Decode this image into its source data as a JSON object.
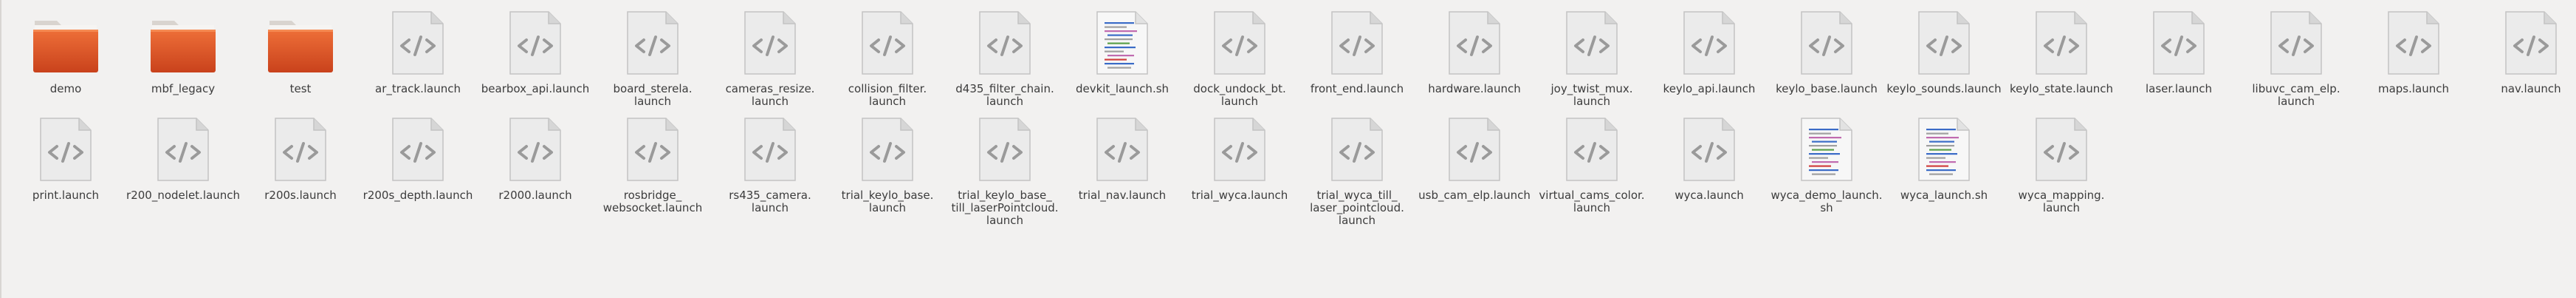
{
  "files": [
    {
      "name": "demo",
      "icon": "folder-icon"
    },
    {
      "name": "mbf_legacy",
      "icon": "folder-icon"
    },
    {
      "name": "test",
      "icon": "folder-icon"
    },
    {
      "name": "ar_track.launch",
      "icon": "code-file-icon"
    },
    {
      "name": "bearbox_api.launch",
      "icon": "code-file-icon"
    },
    {
      "name": "board_sterela.\nlaunch",
      "icon": "code-file-icon"
    },
    {
      "name": "cameras_resize.\nlaunch",
      "icon": "code-file-icon"
    },
    {
      "name": "collision_filter.\nlaunch",
      "icon": "code-file-icon"
    },
    {
      "name": "d435_filter_chain.\nlaunch",
      "icon": "code-file-icon"
    },
    {
      "name": "devkit_launch.sh",
      "icon": "script-file-icon"
    },
    {
      "name": "dock_undock_bt.\nlaunch",
      "icon": "code-file-icon"
    },
    {
      "name": "front_end.launch",
      "icon": "code-file-icon"
    },
    {
      "name": "hardware.launch",
      "icon": "code-file-icon"
    },
    {
      "name": "joy_twist_mux.\nlaunch",
      "icon": "code-file-icon"
    },
    {
      "name": "keylo_api.launch",
      "icon": "code-file-icon"
    },
    {
      "name": "keylo_base.launch",
      "icon": "code-file-icon"
    },
    {
      "name": "keylo_sounds.launch",
      "icon": "code-file-icon"
    },
    {
      "name": "keylo_state.launch",
      "icon": "code-file-icon"
    },
    {
      "name": "laser.launch",
      "icon": "code-file-icon"
    },
    {
      "name": "libuvc_cam_elp.\nlaunch",
      "icon": "code-file-icon"
    },
    {
      "name": "maps.launch",
      "icon": "code-file-icon"
    },
    {
      "name": "nav.launch",
      "icon": "code-file-icon"
    },
    {
      "name": "print.launch",
      "icon": "code-file-icon"
    },
    {
      "name": "r200_nodelet.launch",
      "icon": "code-file-icon"
    },
    {
      "name": "r200s.launch",
      "icon": "code-file-icon"
    },
    {
      "name": "r200s_depth.launch",
      "icon": "code-file-icon"
    },
    {
      "name": "r2000.launch",
      "icon": "code-file-icon"
    },
    {
      "name": "rosbridge_\nwebsocket.launch",
      "icon": "code-file-icon"
    },
    {
      "name": "rs435_camera.\nlaunch",
      "icon": "code-file-icon"
    },
    {
      "name": "trial_keylo_base.\nlaunch",
      "icon": "code-file-icon"
    },
    {
      "name": "trial_keylo_base_\ntill_laserPointcloud.\nlaunch",
      "icon": "code-file-icon"
    },
    {
      "name": "trial_nav.launch",
      "icon": "code-file-icon"
    },
    {
      "name": "trial_wyca.launch",
      "icon": "code-file-icon"
    },
    {
      "name": "trial_wyca_till_\nlaser_pointcloud.\nlaunch",
      "icon": "code-file-icon"
    },
    {
      "name": "usb_cam_elp.launch",
      "icon": "code-file-icon"
    },
    {
      "name": "virtual_cams_color.\nlaunch",
      "icon": "code-file-icon"
    },
    {
      "name": "wyca.launch",
      "icon": "code-file-icon"
    },
    {
      "name": "wyca_demo_launch.\nsh",
      "icon": "script-file-icon"
    },
    {
      "name": "wyca_launch.sh",
      "icon": "script-file-icon"
    },
    {
      "name": "wyca_mapping.\nlaunch",
      "icon": "code-file-icon"
    }
  ],
  "colors": {
    "background": "#f2f1f0",
    "label": "#3c3c3c",
    "folder": "#e2592a"
  }
}
